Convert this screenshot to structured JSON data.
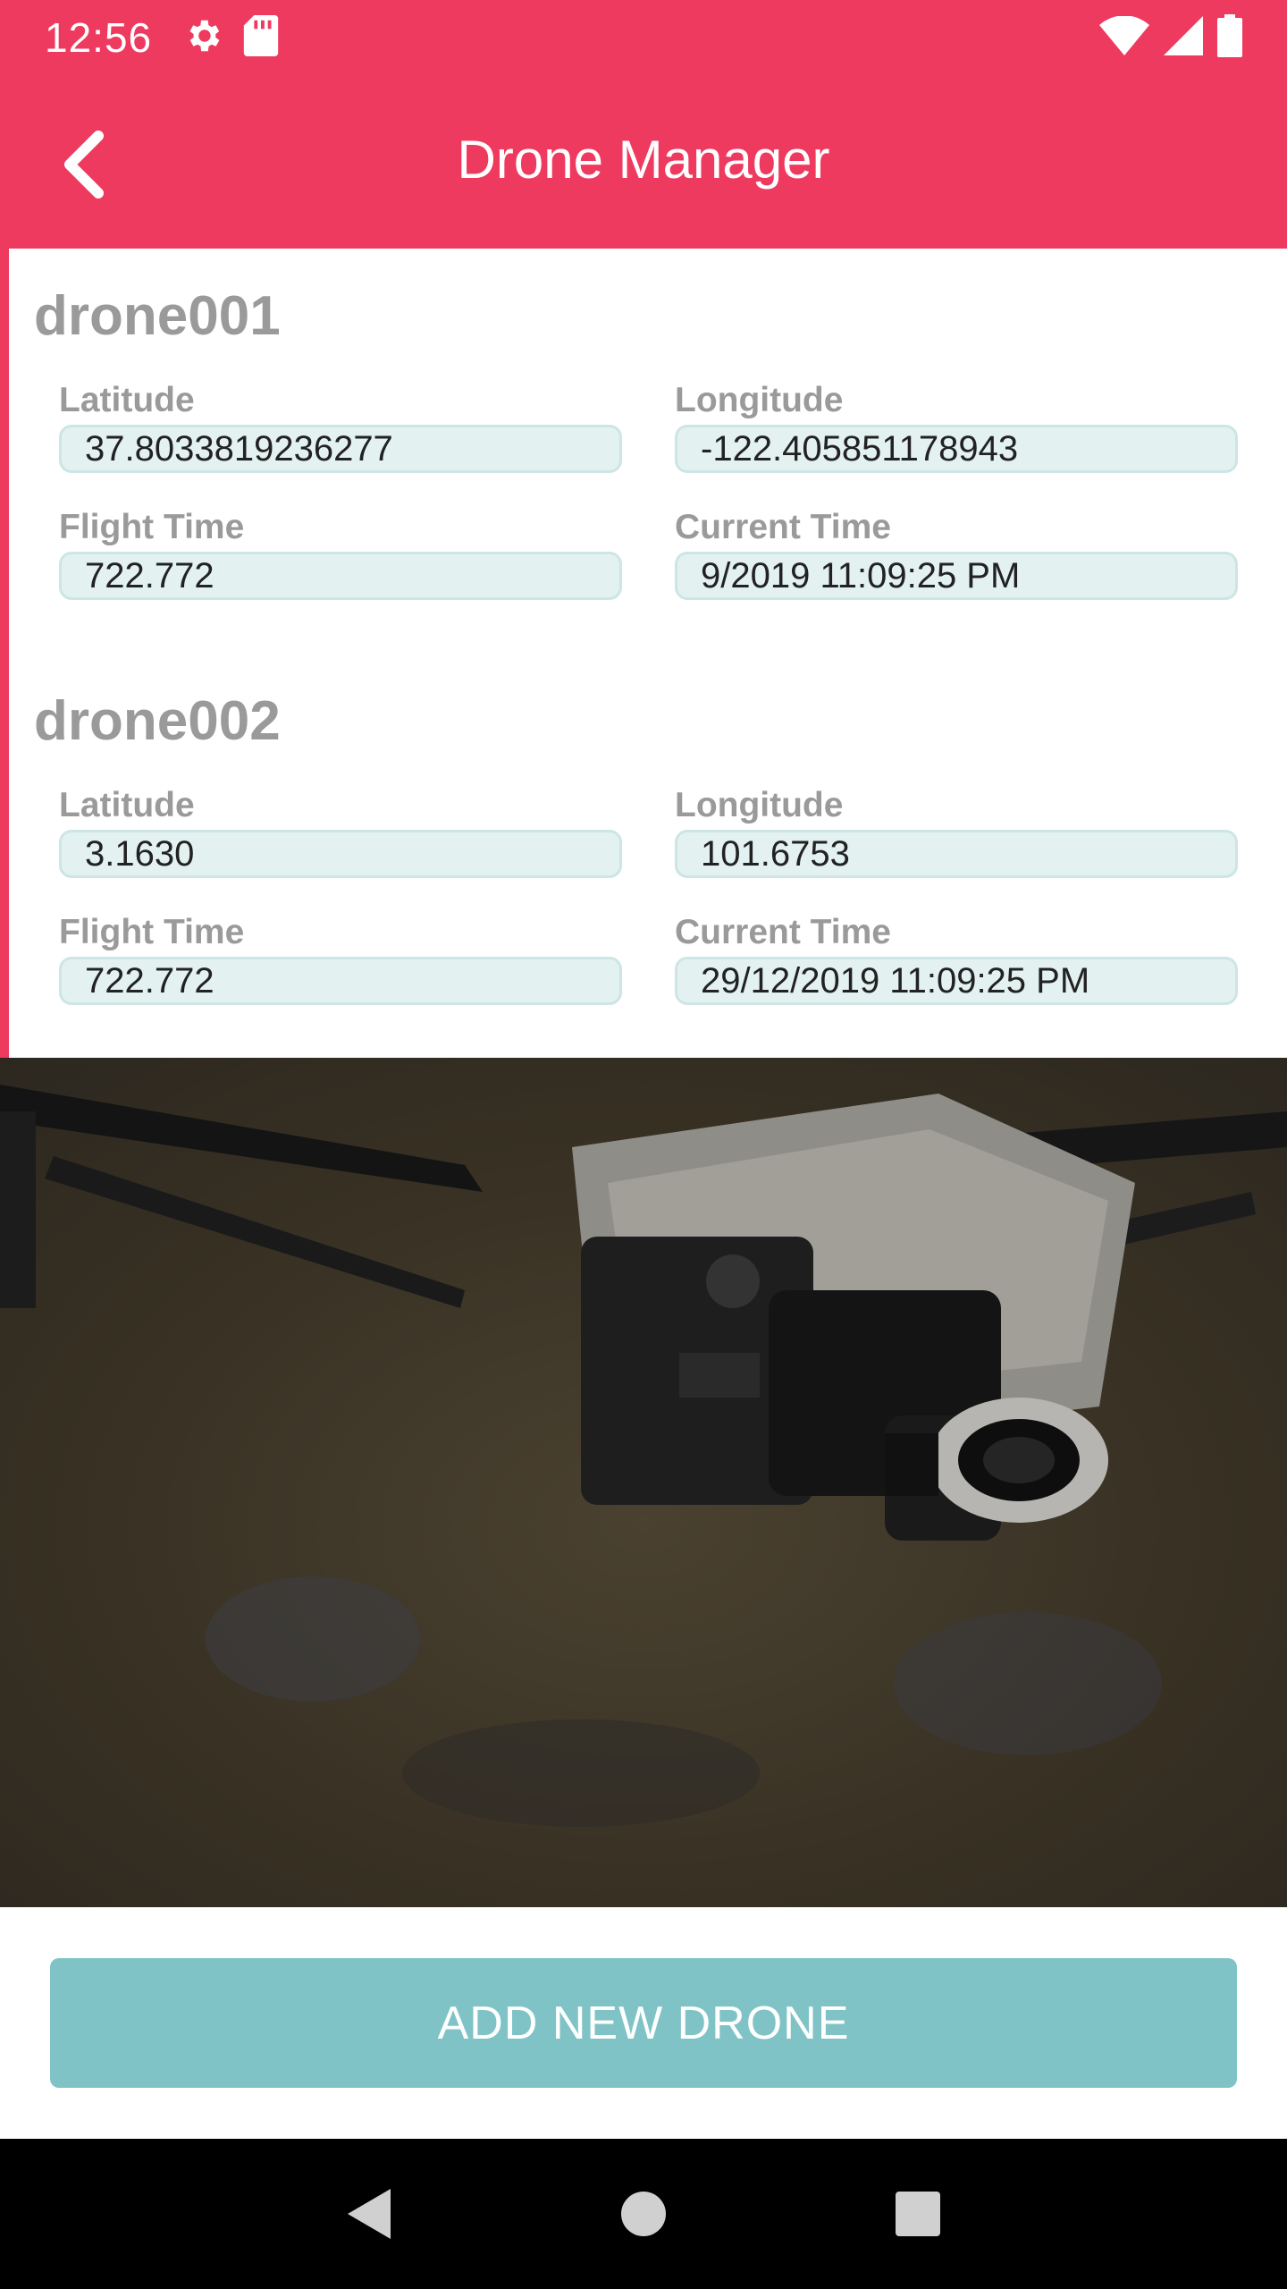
{
  "status_bar": {
    "time": "12:56"
  },
  "app_bar": {
    "title": "Drone Manager"
  },
  "drones": [
    {
      "name": "drone001",
      "latitude_label": "Latitude",
      "latitude": "37.8033819236277",
      "longitude_label": "Longitude",
      "longitude": "-122.405851178943",
      "flight_time_label": "Flight Time",
      "flight_time": "722.772",
      "current_time_label": "Current Time",
      "current_time": "9/2019 11:09:25 PM"
    },
    {
      "name": "drone002",
      "latitude_label": "Latitude",
      "latitude": "3.1630",
      "longitude_label": "Longitude",
      "longitude": "101.6753",
      "flight_time_label": "Flight Time",
      "flight_time": "722.772",
      "current_time_label": "Current Time",
      "current_time": "29/12/2019 11:09:25 PM"
    }
  ],
  "actions": {
    "add_drone_label": "ADD NEW DRONE"
  },
  "colors": {
    "accent": "#ef3a5f",
    "button": "#7fc3c7",
    "field_bg": "#e3f1f1",
    "label": "#9a9a9a"
  },
  "icons": [
    "settings-icon",
    "sd-card-icon",
    "wifi-icon",
    "signal-icon",
    "battery-icon",
    "back-arrow-icon",
    "nav-back-icon",
    "nav-home-icon",
    "nav-recents-icon"
  ]
}
